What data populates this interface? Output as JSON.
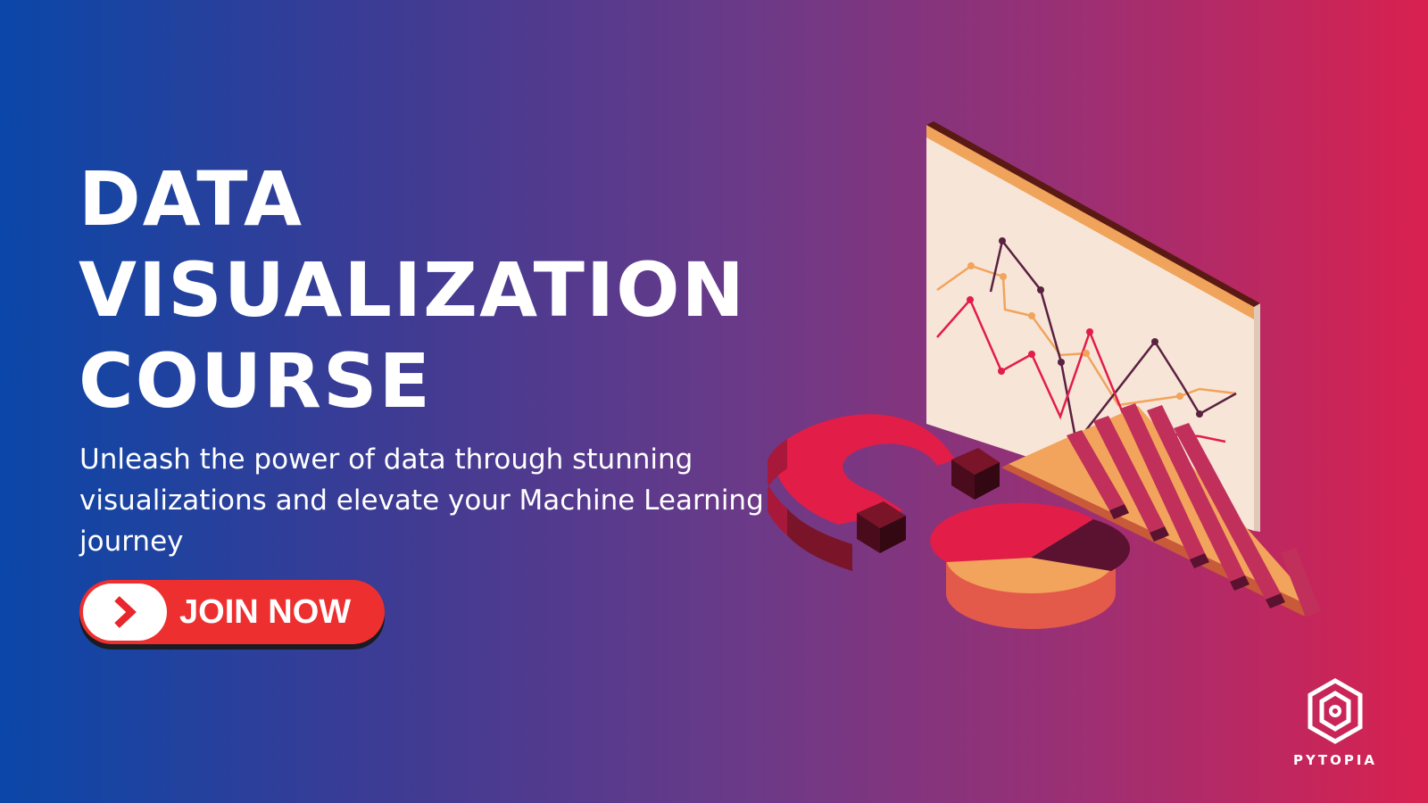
{
  "headline": {
    "line1": "DATA",
    "line2": "VISUALIZATION",
    "line3": "COURSE"
  },
  "subtitle": "Unleash the power of data through stunning visualizations and elevate your Machine Learning journey",
  "cta": {
    "label": "JOIN NOW",
    "icon": "chevron-right-icon"
  },
  "brand": {
    "name": "PYTOPIA",
    "icon": "pytopia-hexagon-logo"
  },
  "illustration": {
    "icons": [
      "chart-board-icon",
      "magnet-icon",
      "pie-chart-icon",
      "staircase-icon"
    ]
  },
  "colors": {
    "gradient_start": "#0a47a8",
    "gradient_end": "#d9214f",
    "button": "#ee2f2f",
    "text": "#ffffff",
    "board": "#f7e5d8",
    "board_edge": "#f0a35a",
    "magnet": "#e21d48",
    "accent_dark": "#5a1230",
    "orange": "#f2a35c"
  }
}
